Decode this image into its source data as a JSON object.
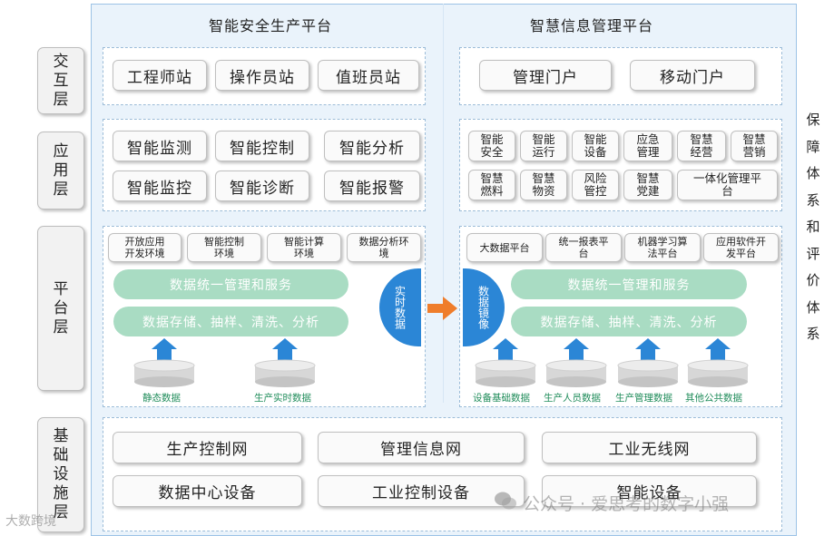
{
  "titles": {
    "left": "智能安全生产平台",
    "right": "智慧信息管理平台"
  },
  "layers": {
    "interaction": [
      "交",
      "互",
      "层"
    ],
    "application": [
      "应",
      "用",
      "层"
    ],
    "platform": [
      "平",
      "台",
      "层"
    ],
    "infrastructure": [
      "基",
      "础",
      "设",
      "施",
      "层"
    ]
  },
  "interaction": {
    "left": [
      "工程师站",
      "操作员站",
      "值班员站"
    ],
    "right": [
      "管理门户",
      "移动门户"
    ]
  },
  "application": {
    "left": [
      "智能监测",
      "智能控制",
      "智能分析",
      "智能监控",
      "智能诊断",
      "智能报警"
    ],
    "right": [
      "智能\n安全",
      "智能\n运行",
      "智能\n设备",
      "应急\n管理",
      "智慧\n经营",
      "智慧\n营销",
      "智慧\n燃料",
      "智慧\n物资",
      "风险\n管控",
      "智慧\n党建",
      "一体化管理平\n台"
    ]
  },
  "platform": {
    "left_envs": [
      "开放应用\n开发环境",
      "智能控制\n环境",
      "智能计算\n环境",
      "数据分析环\n境"
    ],
    "right_envs": [
      "大数据平台",
      "统一报表平\n台",
      "机器学习算\n法平台",
      "应用软件开\n发平台"
    ],
    "mgmt": "数据统一管理和服务",
    "process": "数据存储、抽样、清洗、分析",
    "realtime": "实时数据",
    "mirror": "数据镜像",
    "left_dbs": [
      "静态数据",
      "生产实时数据"
    ],
    "right_dbs": [
      "设备基础数据",
      "生产人员数据",
      "生产管理数据",
      "其他公共数据"
    ]
  },
  "infrastructure": [
    "生产控制网",
    "管理信息网",
    "工业无线网",
    "数据中心设备",
    "工业控制设备",
    "智能设备"
  ],
  "side": [
    "保",
    "障",
    "体",
    "系",
    "和",
    "评",
    "价",
    "体",
    "系"
  ],
  "watermarks": {
    "wechat": "公众号 · 爱思考的数字小强",
    "corner": "大数跨境"
  },
  "icons": {
    "arrow": "right-arrow-icon",
    "up": "up-arrow-icon",
    "db": "database-icon",
    "wechat": "wechat-icon"
  },
  "colors": {
    "blue": "#2b86d6",
    "green_bar": "#a9dcc3",
    "orange_arrow": "#ef7d2b",
    "bg": "#eaf3fb"
  }
}
